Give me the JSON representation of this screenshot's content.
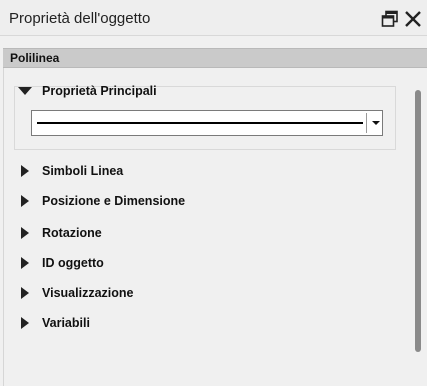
{
  "titlebar": {
    "title": "Proprietà dell'oggetto",
    "restore_icon": "window-restore-icon",
    "close_icon": "close-icon"
  },
  "section": {
    "header": "Polilinea"
  },
  "main_group": {
    "label": "Proprietà Principali",
    "expanded": true,
    "line_style": "solid"
  },
  "groups": [
    {
      "label": "Simboli Linea"
    },
    {
      "label": "Posizione e Dimensione"
    },
    {
      "label": "Rotazione"
    },
    {
      "label": "ID oggetto"
    },
    {
      "label": "Visualizzazione"
    },
    {
      "label": "Variabili"
    }
  ],
  "colors": {
    "header_bg": "#cacaca",
    "panel_bg": "#f0f0f0",
    "scrollbar_thumb": "#8a8a8a"
  }
}
